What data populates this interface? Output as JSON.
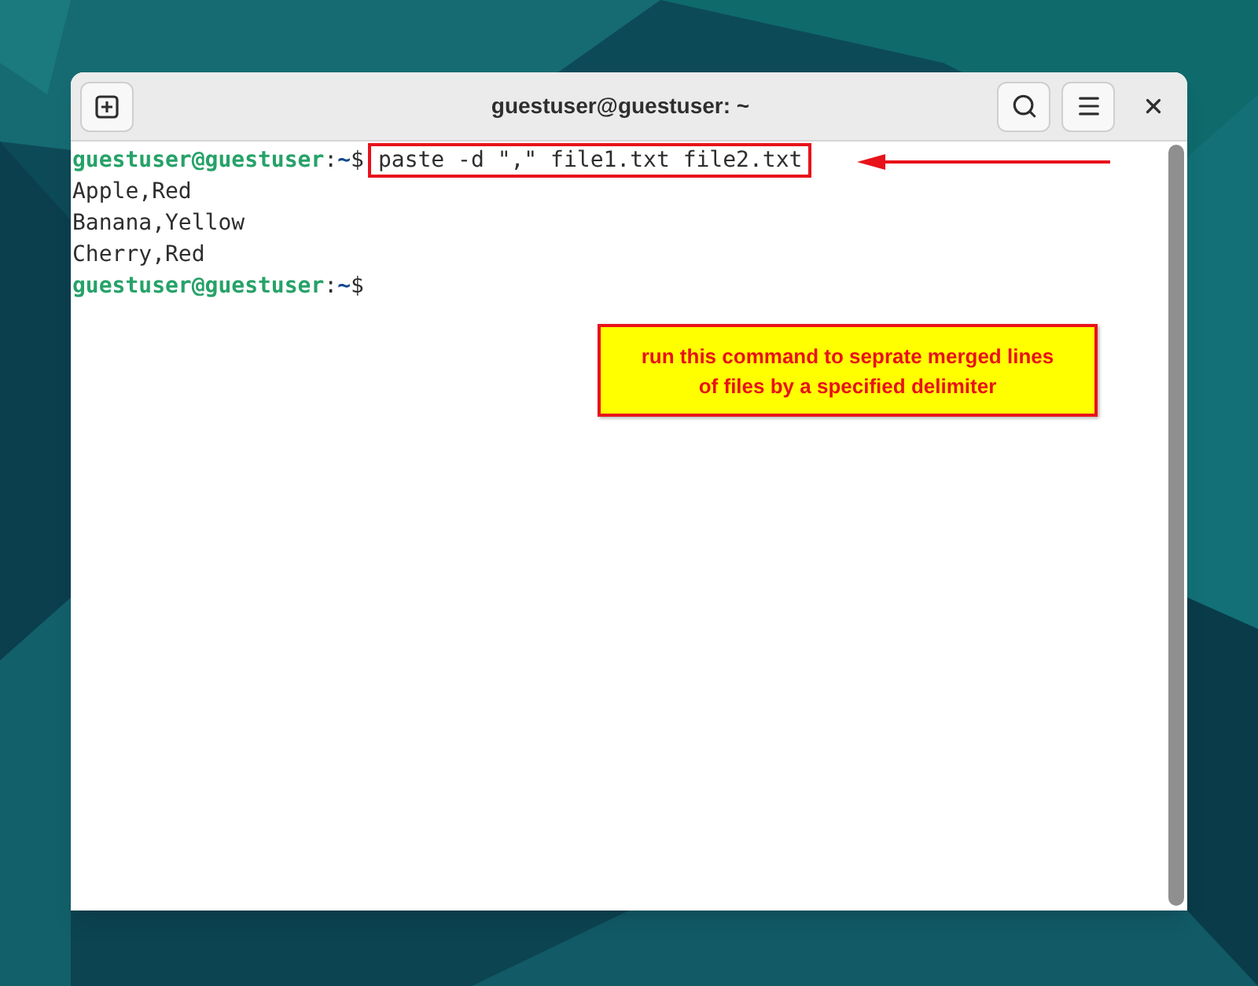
{
  "window": {
    "title": "guestuser@guestuser: ~"
  },
  "lines": [
    {
      "kind": "prompt",
      "user": "guestuser@guestuser",
      "separator": ":",
      "path": "~",
      "symbol": "$",
      "command": "paste -d \",\" file1.txt file2.txt",
      "highlighted": true
    },
    {
      "kind": "output",
      "text": "Apple,Red"
    },
    {
      "kind": "output",
      "text": "Banana,Yellow"
    },
    {
      "kind": "output",
      "text": "Cherry,Red"
    },
    {
      "kind": "prompt",
      "user": "guestuser@guestuser",
      "separator": ":",
      "path": "~",
      "symbol": "$"
    }
  ],
  "annotation": {
    "text": "run this command to seprate merged lines of files by a specified delimiter"
  }
}
